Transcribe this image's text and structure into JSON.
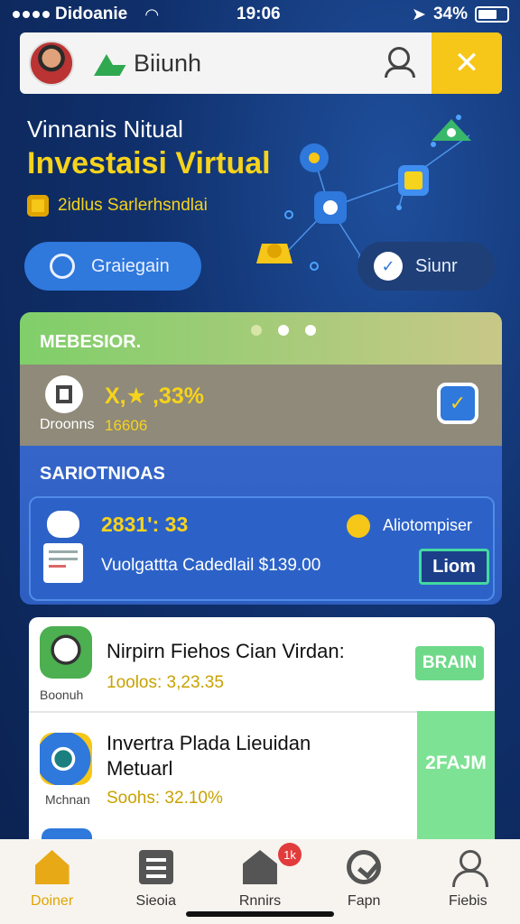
{
  "status_bar": {
    "carrier": "Didoanie",
    "time": "19:06",
    "battery": "34%"
  },
  "header": {
    "brand": "Biiunh",
    "close_glyph": "✕"
  },
  "hero": {
    "subtitle": "Vinnanis Nitual",
    "title": "Investaisi Virtual",
    "tagline": "2idlus Sarlerhsndlai",
    "primary_button": "Graiegain",
    "secondary_button": "Siunr"
  },
  "card": {
    "header": "MEBESIOR.",
    "metric_value": "X,★ ,33%",
    "metric_label": "Droonns",
    "metric_sub": "16606",
    "section_title": "SARIOTNIOAS",
    "transaction": {
      "amount": "2831': 33",
      "description": "Vuolgattta Cadedlail $139.00",
      "meta": "Aliotompiser",
      "action": "Liom"
    }
  },
  "list": [
    {
      "icon_caption": "Boonuh",
      "title": "Nirpirn Fiehos Cian Virdan:",
      "value": "1oolos: 3,23.35",
      "button": "BRAIN",
      "icon_color": "#4caf50"
    },
    {
      "icon_caption": "Mchnan",
      "title": "Invertra Plada Lieuidan Metuarl",
      "value": "Soohs: 32.10%",
      "button": "2FAJM",
      "icon_color": "#2f78dc"
    }
  ],
  "tabs": [
    {
      "label": "Doiner",
      "icon": "home-icon"
    },
    {
      "label": "Sieoia",
      "icon": "list-icon"
    },
    {
      "label": "Rnnirs",
      "icon": "store-icon",
      "badge": "1k"
    },
    {
      "label": "Fapn",
      "icon": "chart-icon"
    },
    {
      "label": "Fiebis",
      "icon": "profile-icon"
    }
  ],
  "colors": {
    "accent_yellow": "#f6c619",
    "primary_blue": "#2f78dc",
    "background": "#10306c",
    "success_green": "#6fd98a"
  }
}
